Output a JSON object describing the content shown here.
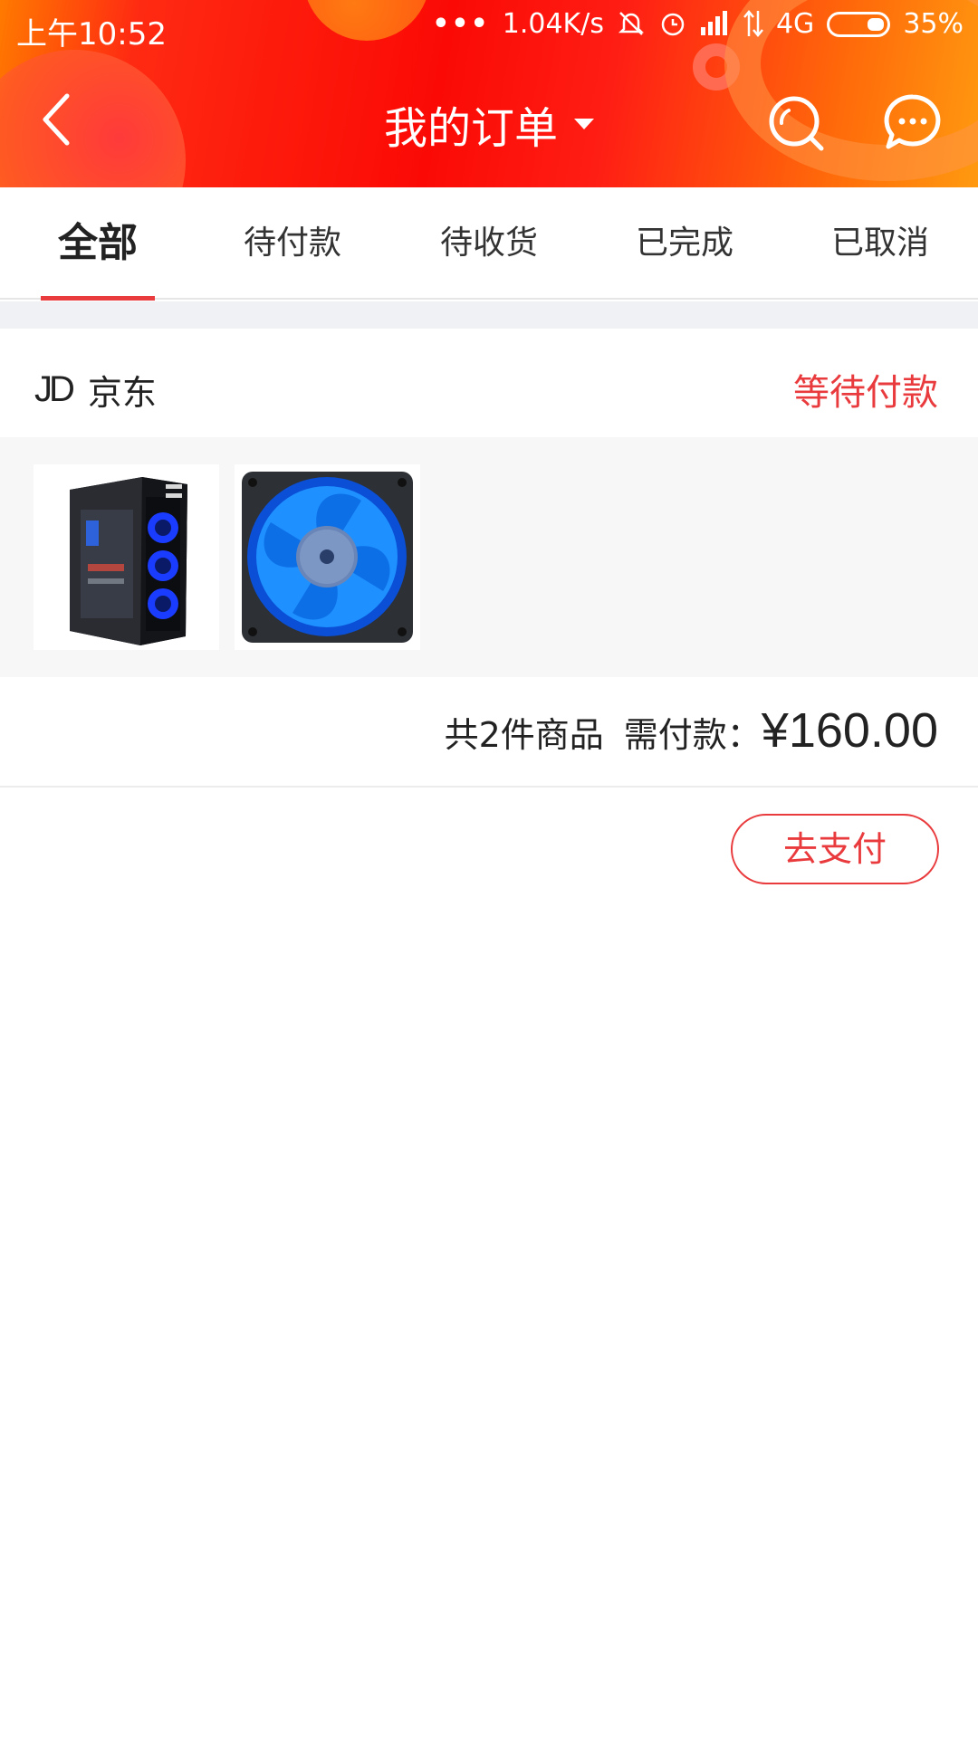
{
  "status_bar": {
    "time": "上午10:52",
    "dots": "•••",
    "net_speed": "1.04K/s",
    "network": "4G",
    "battery": "35%"
  },
  "nav": {
    "title": "我的订单",
    "back_icon": "chevron-left-icon",
    "search_icon": "search-icon",
    "message_icon": "message-icon"
  },
  "tabs": [
    {
      "label": "全部",
      "active": true
    },
    {
      "label": "待付款",
      "active": false
    },
    {
      "label": "待收货",
      "active": false
    },
    {
      "label": "已完成",
      "active": false
    },
    {
      "label": "已取消",
      "active": false
    }
  ],
  "order": {
    "shop_mark": "JD",
    "shop_name": "京东",
    "status": "等待付款",
    "goods": [
      {
        "name": "pc-case-image"
      },
      {
        "name": "blue-led-fan-image"
      }
    ],
    "count_text": "共2件商品",
    "need_pay_label": "需付款：",
    "price": "¥160.00",
    "pay_button": "去支付"
  },
  "colors": {
    "accent": "#e93b3d",
    "header_red": "#fb0a05",
    "header_orange": "#ff9a10"
  }
}
